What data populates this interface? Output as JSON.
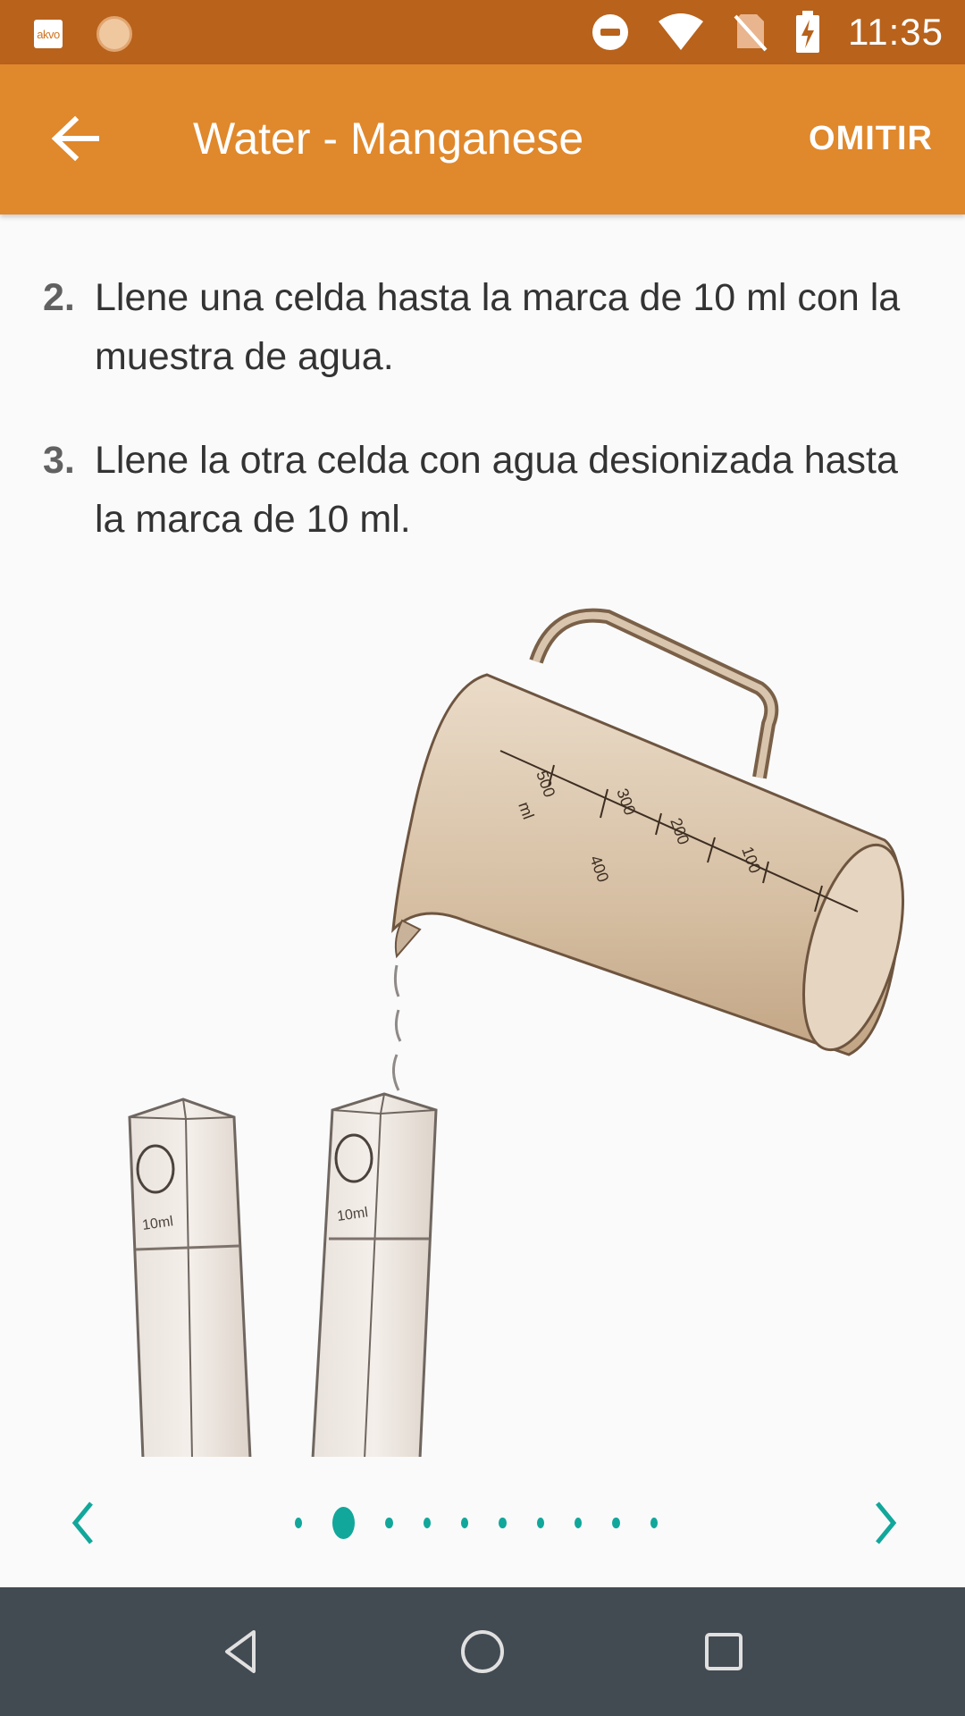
{
  "status_bar": {
    "time": "11:35",
    "left_icons": [
      "akvo-app-icon",
      "sun-app-icon"
    ],
    "akvo_label": "akvo",
    "right_icons": [
      "do-not-disturb-icon",
      "wifi-icon",
      "no-sim-icon",
      "battery-charging-icon"
    ]
  },
  "app_bar": {
    "title": "Water - Manganese",
    "action_label": "OMITIR",
    "back_icon": "arrow-back-icon"
  },
  "steps": [
    {
      "number": "2.",
      "text": "Llene una celda hasta la marca de 10 ml con la muestra de agua."
    },
    {
      "number": "3.",
      "text": "Llene la otra celda con agua desionizada hasta la marca de 10 ml."
    }
  ],
  "illustration": {
    "cell_label_left": "10ml",
    "cell_label_right": "10ml",
    "jug_marks": [
      "ml",
      "500",
      "400",
      "300",
      "200",
      "100"
    ]
  },
  "pager": {
    "page_count": 10,
    "current_index": 1,
    "accent_color": "#12a79b"
  },
  "nav_bar": {
    "buttons": [
      "back-triangle-icon",
      "home-circle-icon",
      "recents-square-icon"
    ]
  },
  "colors": {
    "status_bar": "#b8621c",
    "app_bar": "#e0882c",
    "nav_bar": "#424a52"
  }
}
